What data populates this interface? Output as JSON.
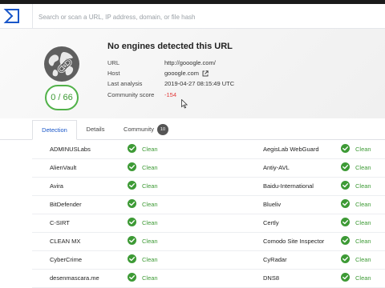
{
  "search": {
    "placeholder": "Search or scan a URL, IP address, domain, or file hash"
  },
  "summary": {
    "title": "No engines detected this URL",
    "score": "0 / 66",
    "fields": [
      {
        "label": "URL",
        "value": "http://gooogle.com/"
      },
      {
        "label": "Host",
        "value": "gooogle.com"
      },
      {
        "label": "Last analysis",
        "value": "2019-04-27 08:15:49 UTC"
      },
      {
        "label": "Community score",
        "value": "-154"
      }
    ]
  },
  "tabs": [
    {
      "label": "Detection",
      "active": true
    },
    {
      "label": "Details"
    },
    {
      "label": "Community",
      "badge": "10"
    }
  ],
  "engines": [
    {
      "left": {
        "name": "ADMINUSLabs",
        "status": "Clean"
      },
      "right": {
        "name": "AegisLab WebGuard",
        "status": "Clean"
      }
    },
    {
      "left": {
        "name": "AlienVault",
        "status": "Clean"
      },
      "right": {
        "name": "Antiy-AVL",
        "status": "Clean"
      }
    },
    {
      "left": {
        "name": "Avira",
        "status": "Clean"
      },
      "right": {
        "name": "Baidu-International",
        "status": "Clean"
      }
    },
    {
      "left": {
        "name": "BitDefender",
        "status": "Clean"
      },
      "right": {
        "name": "Blueliv",
        "status": "Clean"
      }
    },
    {
      "left": {
        "name": "C-SIRT",
        "status": "Clean"
      },
      "right": {
        "name": "Certly",
        "status": "Clean"
      }
    },
    {
      "left": {
        "name": "CLEAN MX",
        "status": "Clean"
      },
      "right": {
        "name": "Comodo Site Inspector",
        "status": "Clean"
      }
    },
    {
      "left": {
        "name": "CyberCrime",
        "status": "Clean"
      },
      "right": {
        "name": "CyRadar",
        "status": "Clean"
      }
    },
    {
      "left": {
        "name": "desenmascara.me",
        "status": "Clean"
      },
      "right": {
        "name": "DNS8",
        "status": "Clean"
      }
    }
  ],
  "colors": {
    "clean": "#3d9a35",
    "negative": "#e23a3a",
    "active_tab": "#1a57c9"
  }
}
